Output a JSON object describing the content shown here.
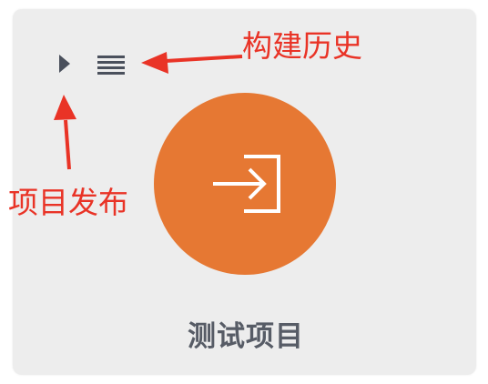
{
  "card": {
    "project_name": "测试项目"
  },
  "toolbar": {
    "play_icon": "play-triangle-icon",
    "menu_icon": "list-menu-icon"
  },
  "main_button": {
    "icon": "sign-in-icon"
  },
  "annotations": {
    "build_history": "构建历史",
    "project_release": "项目发布"
  },
  "colors": {
    "background": "#ffffff",
    "card": "#ededed",
    "accent": "#e67833",
    "icon_dark": "#4a505c",
    "text": "#575c66",
    "annotation": "#e93326"
  }
}
